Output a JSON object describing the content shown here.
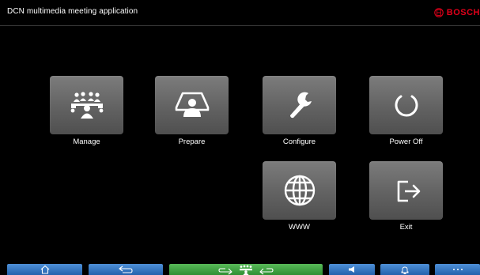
{
  "header": {
    "title": "DCN multimedia meeting application",
    "brand": "BOSCH",
    "brand_color": "#e2001a"
  },
  "tiles": [
    {
      "label": "Manage",
      "icon": "people-meeting-icon"
    },
    {
      "label": "Prepare",
      "icon": "person-monitor-icon"
    },
    {
      "label": "Configure",
      "icon": "wrench-icon"
    },
    {
      "label": "Power Off",
      "icon": "power-icon"
    },
    {
      "label": "WWW",
      "icon": "globe-icon"
    },
    {
      "label": "Exit",
      "icon": "exit-icon"
    }
  ],
  "taskbar": {
    "items": [
      {
        "icon": "home-icon",
        "color": "#2f74c4"
      },
      {
        "icon": "back-arrow-icon",
        "color": "#2f74c4"
      },
      {
        "icon": "meeting-switch-icon",
        "color": "#3aa23d"
      },
      {
        "icon": "speaker-icon",
        "color": "#2f74c4"
      },
      {
        "icon": "bell-icon",
        "color": "#2f74c4"
      },
      {
        "icon": "more-icon",
        "color": "#2f74c4"
      }
    ]
  }
}
